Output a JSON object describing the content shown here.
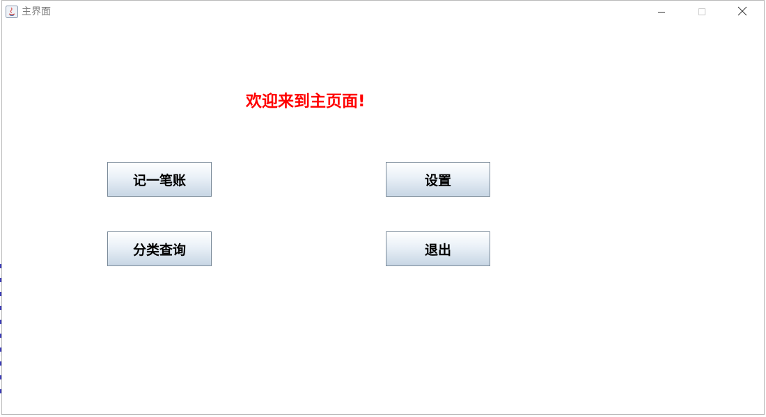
{
  "window": {
    "title": "主界面",
    "controls": {
      "minimize_icon": "minimize-icon",
      "maximize_icon": "maximize-icon",
      "close_icon": "close-icon"
    }
  },
  "main": {
    "welcome_text": "欢迎来到主页面!",
    "welcome_color": "#ff0000",
    "buttons": {
      "record": "记一笔账",
      "settings": "设置",
      "query": "分类查询",
      "exit": "退出"
    }
  }
}
